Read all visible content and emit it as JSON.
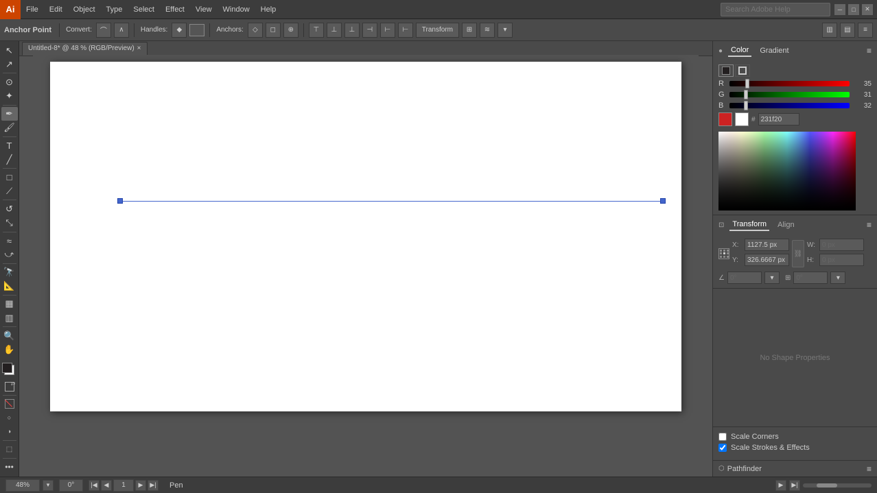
{
  "menubar": {
    "logo": "Ai",
    "menus": [
      "File",
      "Edit",
      "Object",
      "Type",
      "Select",
      "Effect",
      "View",
      "Window",
      "Help"
    ]
  },
  "search": {
    "placeholder": "Search Adobe Help"
  },
  "toolbar": {
    "anchor_point_label": "Anchor Point",
    "convert_label": "Convert:",
    "handles_label": "Handles:",
    "anchors_label": "Anchors:",
    "transform_label": "Transform"
  },
  "tab": {
    "title": "Untitled-8* @ 48 % (RGB/Preview)",
    "close": "×"
  },
  "color_panel": {
    "tab_color": "Color",
    "tab_gradient": "Gradient",
    "r_label": "R",
    "r_value": "35",
    "r_pct": 13.7,
    "g_label": "G",
    "g_value": "31",
    "g_pct": 12.2,
    "b_label": "B",
    "b_value": "32",
    "b_pct": 12.5,
    "hex_label": "#",
    "hex_value": "231f20",
    "no_stroke": "none",
    "fill_color": "#231f20",
    "stroke_color": "#ffffff"
  },
  "transform_panel": {
    "tab_transform": "Transform",
    "tab_align": "Align",
    "x_label": "X:",
    "x_value": "1127.5 px",
    "y_label": "Y:",
    "y_value": "326.6667 px",
    "w_label": "W:",
    "w_value": "0 px",
    "h_label": "H:",
    "h_value": "0 px",
    "angle_label": "∠",
    "angle_value": "0°",
    "shear_label": "⊞",
    "shear_value": "0°",
    "no_shape_text": "No Shape Properties"
  },
  "scale": {
    "scale_corners_label": "Scale Corners",
    "scale_strokes_label": "Scale Strokes & Effects",
    "scale_corners_checked": false,
    "scale_strokes_checked": true
  },
  "pathfinder": {
    "label": "Pathfinder"
  },
  "status_bar": {
    "zoom_value": "48%",
    "rotation": "0°",
    "page_num": "1",
    "tool_label": "Pen"
  }
}
